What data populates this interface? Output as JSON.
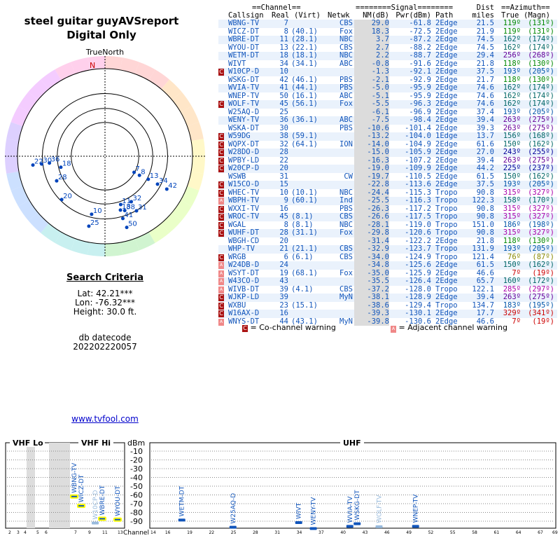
{
  "header": {
    "title_line1": "steel guitar guyAVSreport",
    "title_line2": "Digital Only"
  },
  "compass": {
    "label": "TrueNorth",
    "north": "N",
    "markers": [
      {
        "ch": "22",
        "az": 263,
        "r": 0.83
      },
      {
        "ch": "30",
        "az": 263,
        "r": 0.73
      },
      {
        "ch": "36",
        "az": 263,
        "r": 0.64
      },
      {
        "ch": "18",
        "az": 256,
        "r": 0.52
      },
      {
        "ch": "28",
        "az": 243,
        "r": 0.62
      },
      {
        "ch": "20",
        "az": 225,
        "r": 0.7
      },
      {
        "ch": "7",
        "az": 119,
        "r": 0.38
      },
      {
        "ch": "8",
        "az": 119,
        "r": 0.45
      },
      {
        "ch": "13",
        "az": 118,
        "r": 0.56
      },
      {
        "ch": "34",
        "az": 118,
        "r": 0.68
      },
      {
        "ch": "42",
        "az": 118,
        "r": 0.8
      },
      {
        "ch": "10",
        "az": 193,
        "r": 0.68
      },
      {
        "ch": "25",
        "az": 193,
        "r": 0.82
      },
      {
        "ch": "11",
        "az": 162,
        "r": 0.58
      },
      {
        "ch": "18",
        "az": 164,
        "r": 0.64
      },
      {
        "ch": "38",
        "az": 160,
        "r": 0.66
      },
      {
        "ch": "32",
        "az": 150,
        "r": 0.6
      },
      {
        "ch": "31",
        "az": 150,
        "r": 0.72
      },
      {
        "ch": "41",
        "az": 164,
        "r": 0.74
      },
      {
        "ch": "50",
        "az": 163,
        "r": 0.85
      }
    ]
  },
  "search": {
    "heading": "Search Criteria",
    "lat": "Lat: 42.21***",
    "lon": "Lon: -76.32***",
    "height": "Height: 30.0 ft."
  },
  "db": {
    "label": "db datecode",
    "code": "202202220057"
  },
  "link": {
    "text": "www.tvfool.com"
  },
  "table": {
    "group_channel": "==Channel==",
    "group_signal": "========Signal========",
    "group_dist": "Dist",
    "group_azimuth": "==Azimuth==",
    "col_callsign": "Callsign",
    "col_real": "Real",
    "col_virt": "(Virt)",
    "col_netwk": "Netwk",
    "col_nm": "NM(dB)",
    "col_pwr": "Pwr(dBm)",
    "col_path": "Path",
    "col_miles": "miles",
    "col_true": "True",
    "col_magn": "(Magn)",
    "rows": [
      {
        "warn": "",
        "call": "WBNG-TV",
        "real": "7",
        "virt": "",
        "net": "CBS",
        "nm": "29.0",
        "pwr": "-61.8",
        "path": "2Edge",
        "dist": "21.5",
        "tru": "119º",
        "mag": "(131º)",
        "acolor": "#008800"
      },
      {
        "warn": "",
        "call": "WICZ-DT",
        "real": "8",
        "virt": "(40.1)",
        "net": "Fox",
        "nm": "18.3",
        "pwr": "-72.5",
        "path": "2Edge",
        "dist": "21.9",
        "tru": "119º",
        "mag": "(131º)",
        "acolor": "#008800"
      },
      {
        "warn": "",
        "call": "WBRE-DT",
        "real": "11",
        "virt": "(28.1)",
        "net": "NBC",
        "nm": "3.7",
        "pwr": "-87.2",
        "path": "2Edge",
        "dist": "74.5",
        "tru": "162º",
        "mag": "(174º)",
        "acolor": "#006666"
      },
      {
        "warn": "",
        "call": "WYOU-DT",
        "real": "13",
        "virt": "(22.1)",
        "net": "CBS",
        "nm": "2.7",
        "pwr": "-88.2",
        "path": "2Edge",
        "dist": "74.5",
        "tru": "162º",
        "mag": "(174º)",
        "acolor": "#006666"
      },
      {
        "warn": "",
        "call": "WETM-DT",
        "real": "18",
        "virt": "(18.1)",
        "net": "NBC",
        "nm": "2.2",
        "pwr": "-88.7",
        "path": "2Edge",
        "dist": "29.4",
        "tru": "256º",
        "mag": "(268º)",
        "acolor": "#660099"
      },
      {
        "warn": "",
        "call": "WIVT",
        "real": "34",
        "virt": "(34.1)",
        "net": "ABC",
        "nm": "-0.8",
        "pwr": "-91.6",
        "path": "2Edge",
        "dist": "21.8",
        "tru": "118º",
        "mag": "(130º)",
        "acolor": "#008800"
      },
      {
        "warn": "C",
        "call": "W10CP-D",
        "real": "10",
        "virt": "",
        "net": "",
        "nm": "-1.3",
        "pwr": "-92.1",
        "path": "2Edge",
        "dist": "37.5",
        "tru": "193º",
        "mag": "(205º)",
        "acolor": "#0055aa"
      },
      {
        "warn": "",
        "call": "WSKG-DT",
        "real": "42",
        "virt": "(46.1)",
        "net": "PBS",
        "nm": "-2.1",
        "pwr": "-92.9",
        "path": "2Edge",
        "dist": "21.7",
        "tru": "118º",
        "mag": "(130º)",
        "acolor": "#008800"
      },
      {
        "warn": "",
        "call": "WVIA-TV",
        "real": "41",
        "virt": "(44.1)",
        "net": "PBS",
        "nm": "-5.0",
        "pwr": "-95.9",
        "path": "2Edge",
        "dist": "74.6",
        "tru": "162º",
        "mag": "(174º)",
        "acolor": "#006666"
      },
      {
        "warn": "",
        "call": "WNEP-TV",
        "real": "50",
        "virt": "(16.1)",
        "net": "ABC",
        "nm": "-5.1",
        "pwr": "-95.9",
        "path": "2Edge",
        "dist": "74.6",
        "tru": "162º",
        "mag": "(174º)",
        "acolor": "#006666"
      },
      {
        "warn": "C",
        "call": "WOLF-TV",
        "real": "45",
        "virt": "(56.1)",
        "net": "Fox",
        "nm": "-5.5",
        "pwr": "-96.3",
        "path": "2Edge",
        "dist": "74.6",
        "tru": "162º",
        "mag": "(174º)",
        "acolor": "#006666"
      },
      {
        "warn": "",
        "call": "W25AQ-D",
        "real": "25",
        "virt": "",
        "net": "",
        "nm": "-6.1",
        "pwr": "-96.9",
        "path": "2Edge",
        "dist": "37.4",
        "tru": "193º",
        "mag": "(205º)",
        "acolor": "#0055aa"
      },
      {
        "warn": "",
        "call": "WENY-TV",
        "real": "36",
        "virt": "(36.1)",
        "net": "ABC",
        "nm": "-7.5",
        "pwr": "-98.4",
        "path": "2Edge",
        "dist": "39.4",
        "tru": "263º",
        "mag": "(275º)",
        "acolor": "#660099"
      },
      {
        "warn": "",
        "call": "WSKA-DT",
        "real": "30",
        "virt": "",
        "net": "PBS",
        "nm": "-10.6",
        "pwr": "-101.4",
        "path": "2Edge",
        "dist": "39.3",
        "tru": "263º",
        "mag": "(275º)",
        "acolor": "#660099"
      },
      {
        "warn": "C",
        "call": "W59DG",
        "real": "38",
        "virt": "(59.1)",
        "net": "",
        "nm": "-13.2",
        "pwr": "-104.0",
        "path": "1Edge",
        "dist": "13.7",
        "tru": "156º",
        "mag": "(168º)",
        "acolor": "#006666"
      },
      {
        "warn": "C",
        "call": "WQPX-DT",
        "real": "32",
        "virt": "(64.1)",
        "net": "ION",
        "nm": "-14.0",
        "pwr": "-104.9",
        "path": "2Edge",
        "dist": "61.6",
        "tru": "150º",
        "mag": "(162º)",
        "acolor": "#006666"
      },
      {
        "warn": "C",
        "call": "W28DO-D",
        "real": "28",
        "virt": "",
        "net": "",
        "nm": "-15.0",
        "pwr": "-105.9",
        "path": "2Edge",
        "dist": "27.0",
        "tru": "243º",
        "mag": "(255º)",
        "acolor": "#000099"
      },
      {
        "warn": "C",
        "call": "WPBY-LD",
        "real": "22",
        "virt": "",
        "net": "",
        "nm": "-16.3",
        "pwr": "-107.2",
        "path": "2Edge",
        "dist": "39.4",
        "tru": "263º",
        "mag": "(275º)",
        "acolor": "#660099"
      },
      {
        "warn": "C",
        "call": "W20CP-D",
        "real": "20",
        "virt": "",
        "net": "",
        "nm": "-19.0",
        "pwr": "-109.9",
        "path": "2Edge",
        "dist": "44.2",
        "tru": "225º",
        "mag": "(237º)",
        "acolor": "#000099"
      },
      {
        "warn": "",
        "call": "WSWB",
        "real": "31",
        "virt": "",
        "net": "CW",
        "nm": "-19.7",
        "pwr": "-110.5",
        "path": "2Edge",
        "dist": "61.5",
        "tru": "150º",
        "mag": "(162º)",
        "acolor": "#006666"
      },
      {
        "warn": "C",
        "call": "W15CO-D",
        "real": "15",
        "virt": "",
        "net": "",
        "nm": "-22.8",
        "pwr": "-113.6",
        "path": "2Edge",
        "dist": "37.5",
        "tru": "193º",
        "mag": "(205º)",
        "acolor": "#0055aa"
      },
      {
        "warn": "C",
        "call": "WHEC-TV",
        "real": "10",
        "virt": "(10.1)",
        "net": "NBC",
        "nm": "-24.4",
        "pwr": "-115.3",
        "path": "Tropo",
        "dist": "90.8",
        "tru": "315º",
        "mag": "(327º)",
        "acolor": "#aa00aa"
      },
      {
        "warn": "A",
        "call": "WBPH-TV",
        "real": "9",
        "virt": "(60.1)",
        "net": "Ind",
        "nm": "-25.5",
        "pwr": "-116.3",
        "path": "Tropo",
        "dist": "122.3",
        "tru": "158º",
        "mag": "(170º)",
        "acolor": "#006666"
      },
      {
        "warn": "C",
        "call": "WXXI-TV",
        "real": "16",
        "virt": "",
        "net": "PBS",
        "nm": "-26.3",
        "pwr": "-117.2",
        "path": "Tropo",
        "dist": "90.8",
        "tru": "315º",
        "mag": "(327º)",
        "acolor": "#aa00aa"
      },
      {
        "warn": "C",
        "call": "WROC-TV",
        "real": "45",
        "virt": "(8.1)",
        "net": "CBS",
        "nm": "-26.6",
        "pwr": "-117.5",
        "path": "Tropo",
        "dist": "90.8",
        "tru": "315º",
        "mag": "(327º)",
        "acolor": "#aa00aa"
      },
      {
        "warn": "C",
        "call": "WGAL",
        "real": "8",
        "virt": "(8.1)",
        "net": "NBC",
        "nm": "-28.1",
        "pwr": "-119.0",
        "path": "Tropo",
        "dist": "151.0",
        "tru": "186º",
        "mag": "(198º)",
        "acolor": "#0055aa"
      },
      {
        "warn": "C",
        "call": "WUHF-DT",
        "real": "28",
        "virt": "(31.1)",
        "net": "Fox",
        "nm": "-29.8",
        "pwr": "-120.6",
        "path": "Tropo",
        "dist": "90.8",
        "tru": "315º",
        "mag": "(327º)",
        "acolor": "#aa00aa"
      },
      {
        "warn": "",
        "call": "WBGH-CD",
        "real": "20",
        "virt": "",
        "net": "",
        "nm": "-31.4",
        "pwr": "-122.2",
        "path": "2Edge",
        "dist": "21.8",
        "tru": "118º",
        "mag": "(130º)",
        "acolor": "#008800"
      },
      {
        "warn": "",
        "call": "WHP-TV",
        "real": "21",
        "virt": "(21.1)",
        "net": "CBS",
        "nm": "-32.9",
        "pwr": "-123.7",
        "path": "Tropo",
        "dist": "131.9",
        "tru": "193º",
        "mag": "(205º)",
        "acolor": "#0055aa"
      },
      {
        "warn": "C",
        "call": "WRGB",
        "real": "6",
        "virt": "(6.1)",
        "net": "CBS",
        "nm": "-34.0",
        "pwr": "-124.9",
        "path": "Tropo",
        "dist": "121.4",
        "tru": "76º",
        "mag": "(87º)",
        "acolor": "#888800"
      },
      {
        "warn": "A",
        "call": "W24DB-D",
        "real": "24",
        "virt": "",
        "net": "",
        "nm": "-34.8",
        "pwr": "-125.6",
        "path": "2Edge",
        "dist": "61.5",
        "tru": "150º",
        "mag": "(162º)",
        "acolor": "#006666"
      },
      {
        "warn": "A",
        "call": "WSYT-DT",
        "real": "19",
        "virt": "(68.1)",
        "net": "Fox",
        "nm": "-35.0",
        "pwr": "-125.9",
        "path": "2Edge",
        "dist": "46.6",
        "tru": "7º",
        "mag": "(19º)",
        "acolor": "#cc0000"
      },
      {
        "warn": "A",
        "call": "W43CO-D",
        "real": "43",
        "virt": "",
        "net": "",
        "nm": "-35.5",
        "pwr": "-126.4",
        "path": "2Edge",
        "dist": "65.7",
        "tru": "160º",
        "mag": "(172º)",
        "acolor": "#006666"
      },
      {
        "warn": "A",
        "call": "WIVB-DT",
        "real": "39",
        "virt": "(4.1)",
        "net": "CBS",
        "nm": "-37.2",
        "pwr": "-128.0",
        "path": "Tropo",
        "dist": "122.1",
        "tru": "285º",
        "mag": "(297º)",
        "acolor": "#aa00aa"
      },
      {
        "warn": "C",
        "call": "WJKP-LD",
        "real": "39",
        "virt": "",
        "net": "MyN",
        "nm": "-38.1",
        "pwr": "-128.9",
        "path": "2Edge",
        "dist": "39.4",
        "tru": "263º",
        "mag": "(275º)",
        "acolor": "#660099"
      },
      {
        "warn": "C",
        "call": "WXBU",
        "real": "23",
        "virt": "(15.1)",
        "net": "",
        "nm": "-38.6",
        "pwr": "-129.4",
        "path": "Tropo",
        "dist": "134.7",
        "tru": "183º",
        "mag": "(195º)",
        "acolor": "#0055aa"
      },
      {
        "warn": "C",
        "call": "W16AX-D",
        "real": "16",
        "virt": "",
        "net": "",
        "nm": "-39.3",
        "pwr": "-130.1",
        "path": "2Edge",
        "dist": "17.7",
        "tru": "329º",
        "mag": "(341º)",
        "acolor": "#cc0000"
      },
      {
        "warn": "A",
        "call": "WNYS-DT",
        "real": "44",
        "virt": "(43.1)",
        "net": "MyN",
        "nm": "-39.8",
        "pwr": "-130.6",
        "path": "2Edge",
        "dist": "46.6",
        "tru": "7º",
        "mag": "(19º)",
        "acolor": "#cc0000"
      }
    ]
  },
  "legend": {
    "co_text": "= Co-channel warning",
    "adj_text": "= Adjacent channel warning",
    "co_mark": "C",
    "adj_mark": "A"
  },
  "spectrum": {
    "vhf_lo": "VHF Lo",
    "vhf_hi": "VHF Hi",
    "uhf": "UHF",
    "dbm": "dBm",
    "channel": "Channel",
    "dbm_ticks": [
      "-10",
      "-20",
      "-30",
      "-40",
      "-50",
      "-60",
      "-70",
      "-80",
      "-90"
    ],
    "vhf_lo_chans": [
      "2",
      "3",
      "4",
      "5",
      "6"
    ],
    "vhf_hi_chans": [
      "7",
      "9",
      "11",
      "13"
    ],
    "uhf_chans": [
      "14",
      "16",
      "19",
      "22",
      "25",
      "28",
      "31",
      "34",
      "37",
      "40",
      "43",
      "46",
      "49",
      "52",
      "55",
      "58",
      "61",
      "64",
      "67",
      "69"
    ],
    "bars": [
      {
        "name": "WBNG-TV",
        "band": "hi",
        "ch": 7,
        "pwr": -61.8,
        "faded": false
      },
      {
        "name": "WICZ-DT",
        "band": "hi",
        "ch": 8,
        "pwr": -72.5,
        "faded": false
      },
      {
        "name": "W10CP-D",
        "band": "hi",
        "ch": 10,
        "pwr": -92.1,
        "faded": true
      },
      {
        "name": "WBRE-DT",
        "band": "hi",
        "ch": 11,
        "pwr": -87.2,
        "faded": false
      },
      {
        "name": "WYOU-DT",
        "band": "hi",
        "ch": 13,
        "pwr": -88.2,
        "faded": false
      },
      {
        "name": "WETM-DT",
        "band": "uhf",
        "ch": 18,
        "pwr": -88.7,
        "faded": false
      },
      {
        "name": "W25AQ-D",
        "band": "uhf",
        "ch": 25,
        "pwr": -96.9,
        "faded": false
      },
      {
        "name": "WIVT",
        "band": "uhf",
        "ch": 34,
        "pwr": -91.6,
        "faded": false
      },
      {
        "name": "WENY-TV",
        "band": "uhf",
        "ch": 36,
        "pwr": -98.4,
        "faded": false
      },
      {
        "name": "WVIA-TV",
        "band": "uhf",
        "ch": 41,
        "pwr": -95.9,
        "faded": false
      },
      {
        "name": "WSKG-DT",
        "band": "uhf",
        "ch": 42,
        "pwr": -92.9,
        "faded": false
      },
      {
        "name": "WOLF-TV",
        "band": "uhf",
        "ch": 45,
        "pwr": -96.3,
        "faded": true
      },
      {
        "name": "WNEP-TV",
        "band": "uhf",
        "ch": 50,
        "pwr": -95.9,
        "faded": false
      }
    ]
  }
}
